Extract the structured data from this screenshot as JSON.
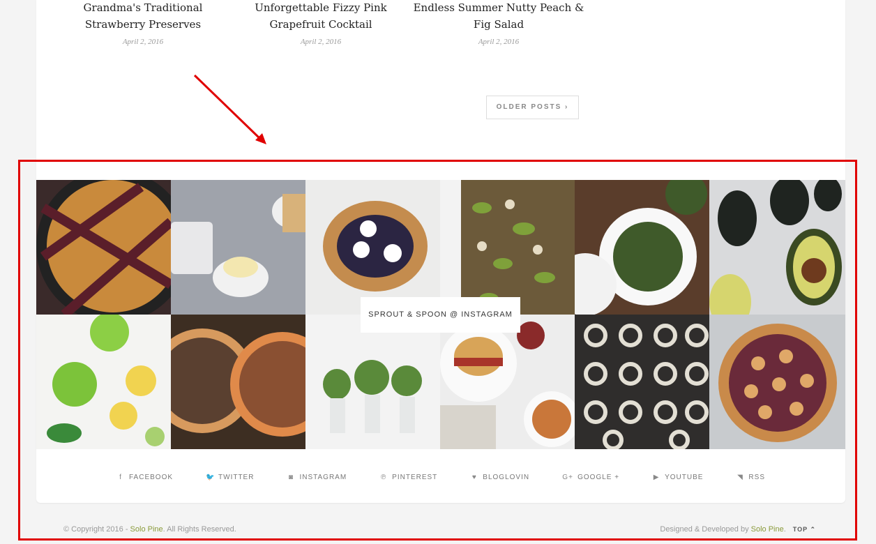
{
  "posts": [
    {
      "title_line1": "Grandma's Traditional",
      "title_line2": "Strawberry Preserves",
      "date": "April 2, 2016"
    },
    {
      "title_line1": "Unforgettable Fizzy Pink",
      "title_line2": "Grapefruit Cocktail",
      "date": "April 2, 2016"
    },
    {
      "title_line1": "Endless Summer Nutty Peach &",
      "title_line2": "Fig Salad",
      "date": "April 2, 2016"
    }
  ],
  "pagination": {
    "older_label": "OLDER POSTS ›"
  },
  "instagram": {
    "label": "SPROUT & SPOON @ INSTAGRAM"
  },
  "social": [
    {
      "icon": "facebook-icon",
      "glyph": "f",
      "label": "FACEBOOK"
    },
    {
      "icon": "twitter-icon",
      "glyph": "🐦",
      "label": "TWITTER"
    },
    {
      "icon": "instagram-icon",
      "glyph": "◙",
      "label": "INSTAGRAM"
    },
    {
      "icon": "pinterest-icon",
      "glyph": "℗",
      "label": "PINTEREST"
    },
    {
      "icon": "heart-icon",
      "glyph": "♥",
      "label": "BLOGLOVIN"
    },
    {
      "icon": "google-plus-icon",
      "glyph": "G+",
      "label": "GOOGLE +"
    },
    {
      "icon": "youtube-icon",
      "glyph": "▶",
      "label": "YOUTUBE"
    },
    {
      "icon": "rss-icon",
      "glyph": "◥",
      "label": "RSS"
    }
  ],
  "footer": {
    "copyright_prefix": "© Copyright 2016 - ",
    "copyright_link": "Solo Pine",
    "copyright_suffix": ". All Rights Reserved.",
    "credit_prefix": "Designed & Developed by ",
    "credit_link": "Solo Pine",
    "credit_suffix": ".",
    "top_label": "TOP ⌃"
  },
  "colors": {
    "accent": "#8a9a3a",
    "annotation": "#e00000"
  }
}
